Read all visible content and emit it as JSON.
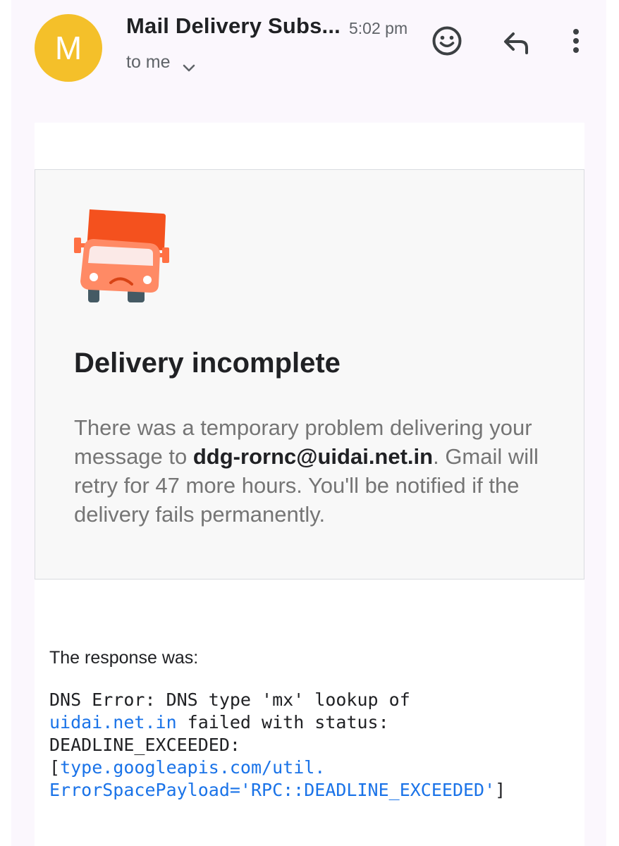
{
  "header": {
    "avatar_letter": "M",
    "sender": "Mail Delivery Subs...",
    "time": "5:02 pm",
    "recipient": "to me",
    "icons": [
      "emoji-react-icon",
      "reply-icon",
      "more-vert-icon"
    ]
  },
  "notice": {
    "title": "Delivery incomplete",
    "text_before": "There was a temporary problem delivering your message to ",
    "address": "ddg-rornc@uidai.net.in",
    "text_after": ". Gmail will retry for 47 more hours. You'll be notified if the delivery fails permanently."
  },
  "response": {
    "label": "The response was:",
    "line1": "DNS Error: DNS type 'mx' lookup of",
    "domain_link": "uidai.net.in",
    "line2_rest": " failed with status:",
    "line3": "DEADLINE_EXCEEDED:",
    "bracket_open": "[",
    "link_line1": "type.googleapis.com/util.",
    "link_line2": "ErrorSpacePayload='RPC::DEADLINE_EXCEEDED'",
    "bracket_close": "]"
  },
  "colors": {
    "avatar": "#f4c02a",
    "link": "#1a73e8",
    "truck": "#f4511e",
    "truck_front": "#ff8a65"
  }
}
